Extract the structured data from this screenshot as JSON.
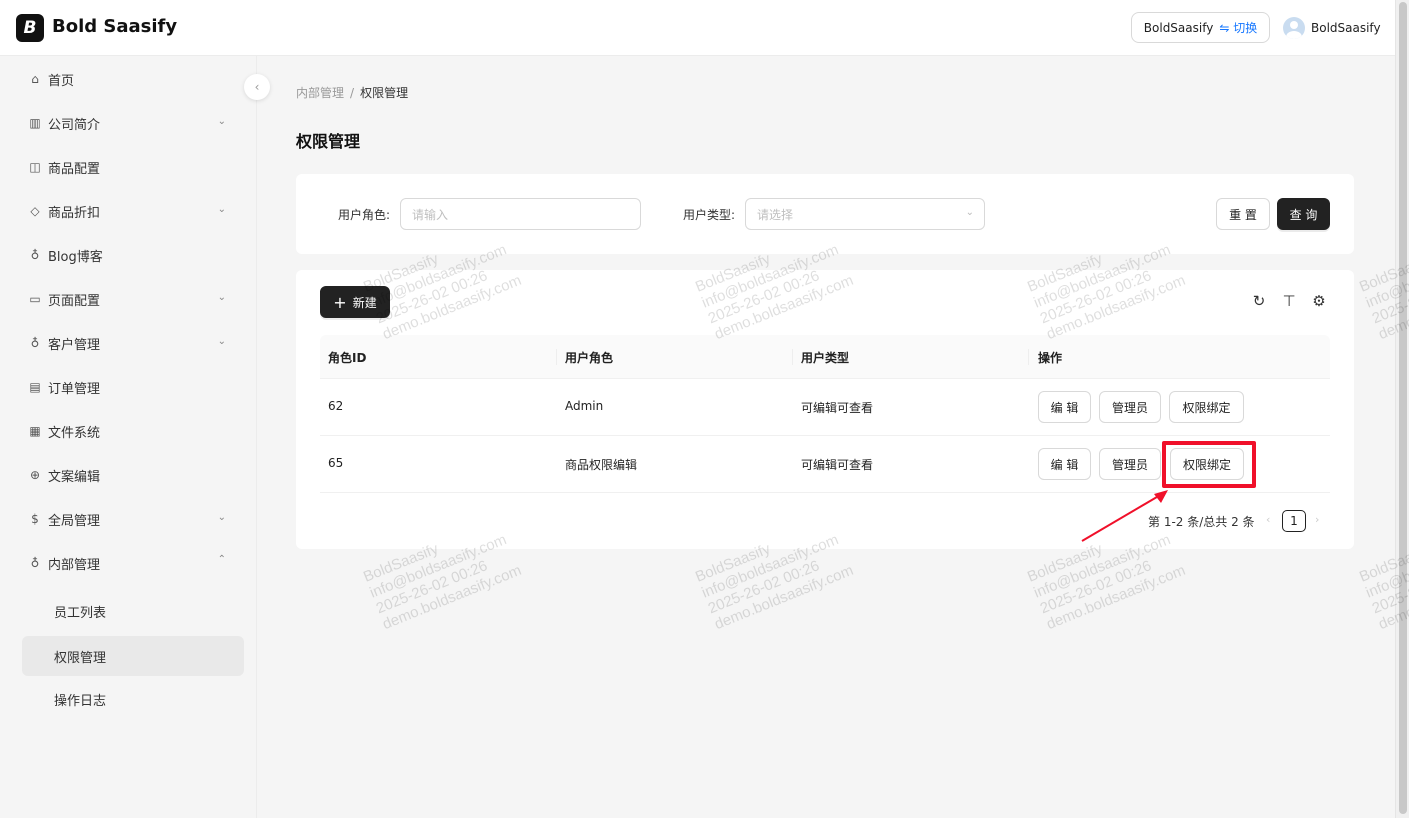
{
  "app": {
    "logo_letter": "B",
    "name": "Bold Saasify"
  },
  "header": {
    "tenant_name": "BoldSaasify",
    "switch_label": "⇋ 切换",
    "user_name": "BoldSaasify"
  },
  "sidebar": {
    "items": [
      {
        "label": "首页",
        "icon": "home-icon"
      },
      {
        "label": "公司简介",
        "icon": "building-icon"
      },
      {
        "label": "商品配置",
        "icon": "box-icon"
      },
      {
        "label": "商品折扣",
        "icon": "tag-icon"
      },
      {
        "label": "Blog博客",
        "icon": "users-icon"
      },
      {
        "label": "页面配置",
        "icon": "monitor-icon"
      },
      {
        "label": "客户管理",
        "icon": "team-icon"
      },
      {
        "label": "订单管理",
        "icon": "file-icon"
      },
      {
        "label": "文件系统",
        "icon": "folder-icon"
      },
      {
        "label": "文案编辑",
        "icon": "globe-icon"
      },
      {
        "label": "全局管理",
        "icon": "dollar-icon"
      },
      {
        "label": "内部管理",
        "icon": "user-group-icon"
      },
      {
        "label": "员工列表"
      },
      {
        "label": "权限管理"
      },
      {
        "label": "操作日志"
      }
    ]
  },
  "breadcrumb": {
    "parent": "内部管理",
    "separator": "/",
    "current": "权限管理"
  },
  "page": {
    "title": "权限管理"
  },
  "search": {
    "role_label": "用户角色:",
    "role_placeholder": "请输入",
    "type_label": "用户类型:",
    "type_placeholder": "请选择",
    "reset_label": "重 置",
    "query_label": "查 询"
  },
  "table": {
    "new_label": "新建",
    "columns": [
      "角色ID",
      "用户角色",
      "用户类型",
      "操作"
    ],
    "rows": [
      {
        "id": "62",
        "role": "Admin",
        "type": "可编辑可查看"
      },
      {
        "id": "65",
        "role": "商品权限编辑",
        "type": "可编辑可查看"
      }
    ],
    "actions": {
      "edit": "编 辑",
      "admin": "管理员",
      "bind": "权限绑定"
    },
    "pagination": {
      "summary": "第 1-2 条/总共 2 条",
      "current_page": "1"
    }
  },
  "watermark": "BoldSaasify\ninfo@boldsaasify.com\n2025-26-02 00:26\ndemo.boldsaasify.com",
  "colors": {
    "primary_dark": "#222222",
    "highlight": "#f0102a",
    "link_blue": "#1677ff"
  }
}
